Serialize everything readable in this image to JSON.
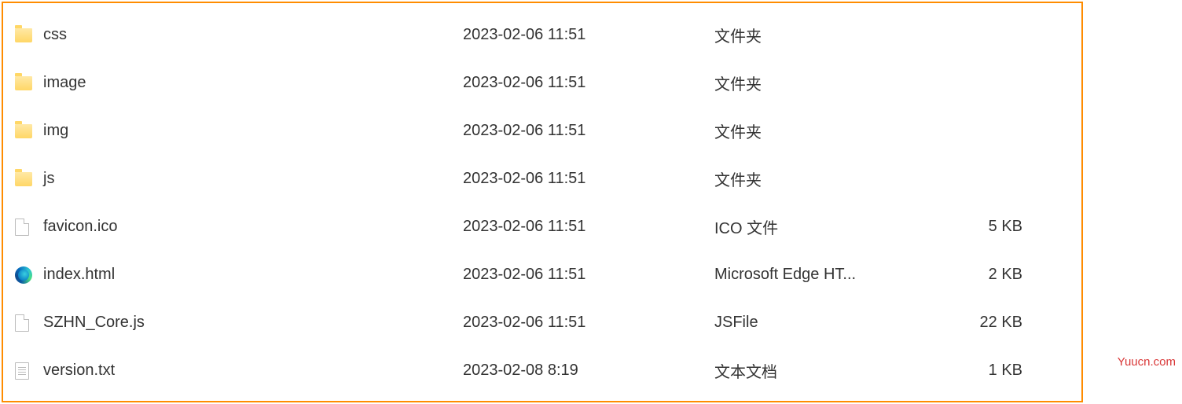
{
  "files": [
    {
      "icon": "folder",
      "name": "css",
      "date": "2023-02-06 11:51",
      "type": "文件夹",
      "size": ""
    },
    {
      "icon": "folder",
      "name": "image",
      "date": "2023-02-06 11:51",
      "type": "文件夹",
      "size": ""
    },
    {
      "icon": "folder",
      "name": "img",
      "date": "2023-02-06 11:51",
      "type": "文件夹",
      "size": ""
    },
    {
      "icon": "folder",
      "name": "js",
      "date": "2023-02-06 11:51",
      "type": "文件夹",
      "size": ""
    },
    {
      "icon": "file",
      "name": "favicon.ico",
      "date": "2023-02-06 11:51",
      "type": "ICO 文件",
      "size": "5 KB"
    },
    {
      "icon": "edge",
      "name": "index.html",
      "date": "2023-02-06 11:51",
      "type": "Microsoft Edge HT...",
      "size": "2 KB"
    },
    {
      "icon": "file",
      "name": "SZHN_Core.js",
      "date": "2023-02-06 11:51",
      "type": "JSFile",
      "size": "22 KB"
    },
    {
      "icon": "txt",
      "name": "version.txt",
      "date": "2023-02-08 8:19",
      "type": "文本文档",
      "size": "1 KB"
    }
  ],
  "watermark": "Yuucn.com"
}
